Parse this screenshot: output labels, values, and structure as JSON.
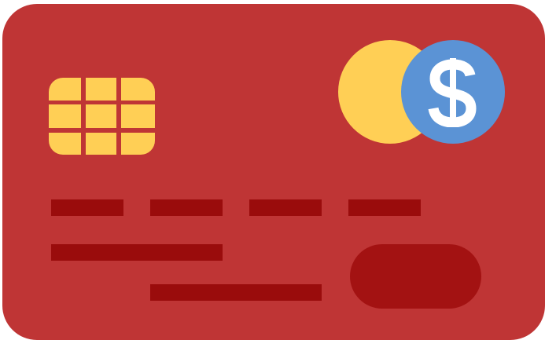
{
  "card": {
    "colors": {
      "card_body": "#bf3535",
      "chip": "#ffcf55",
      "coin_left": "#ffcf55",
      "coin_right": "#5b93d5",
      "dollar_symbol": "#ffffff",
      "number_bars": "#9a0c0c",
      "pill_button": "#a31212"
    },
    "icons": {
      "chip": "card-chip-icon",
      "coins": "dollar-coin-icon"
    },
    "number_groups": 4
  }
}
